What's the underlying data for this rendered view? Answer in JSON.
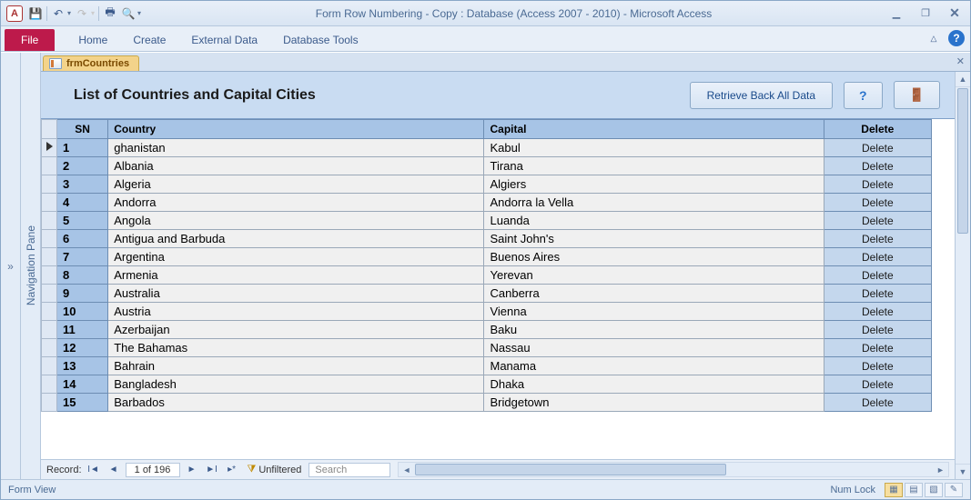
{
  "title": "Form Row Numbering - Copy : Database (Access 2007 - 2010)  -  Microsoft Access",
  "qat": {
    "app_letter": "A"
  },
  "tabs": {
    "file": "File",
    "home": "Home",
    "create": "Create",
    "external": "External Data",
    "dbtools": "Database Tools"
  },
  "nav_pane": {
    "label": "Navigation Pane",
    "collapse": "»"
  },
  "tab_name": "frmCountries",
  "form": {
    "title": "List of Countries and Capital Cities",
    "retrieve_btn": "Retrieve Back All Data",
    "headers": {
      "sn": "SN",
      "country": "Country",
      "capital": "Capital",
      "delete": "Delete"
    },
    "delete_label": "Delete",
    "rows": [
      {
        "sn": "1",
        "country": "ghanistan",
        "capital": "Kabul"
      },
      {
        "sn": "2",
        "country": "Albania",
        "capital": "Tirana"
      },
      {
        "sn": "3",
        "country": "Algeria",
        "capital": "Algiers"
      },
      {
        "sn": "4",
        "country": "Andorra",
        "capital": "Andorra la Vella"
      },
      {
        "sn": "5",
        "country": "Angola",
        "capital": "Luanda"
      },
      {
        "sn": "6",
        "country": "Antigua and Barbuda",
        "capital": "Saint John's"
      },
      {
        "sn": "7",
        "country": "Argentina",
        "capital": "Buenos Aires"
      },
      {
        "sn": "8",
        "country": "Armenia",
        "capital": "Yerevan"
      },
      {
        "sn": "9",
        "country": "Australia",
        "capital": "Canberra"
      },
      {
        "sn": "10",
        "country": "Austria",
        "capital": "Vienna"
      },
      {
        "sn": "11",
        "country": "Azerbaijan",
        "capital": "Baku"
      },
      {
        "sn": "12",
        "country": "The Bahamas",
        "capital": "Nassau"
      },
      {
        "sn": "13",
        "country": "Bahrain",
        "capital": "Manama"
      },
      {
        "sn": "14",
        "country": "Bangladesh",
        "capital": "Dhaka"
      },
      {
        "sn": "15",
        "country": "Barbados",
        "capital": "Bridgetown"
      }
    ]
  },
  "recnav": {
    "label": "Record:",
    "position": "1 of 196",
    "filter": "Unfiltered",
    "search_placeholder": "Search"
  },
  "status": {
    "view": "Form View",
    "numlock": "Num Lock"
  }
}
